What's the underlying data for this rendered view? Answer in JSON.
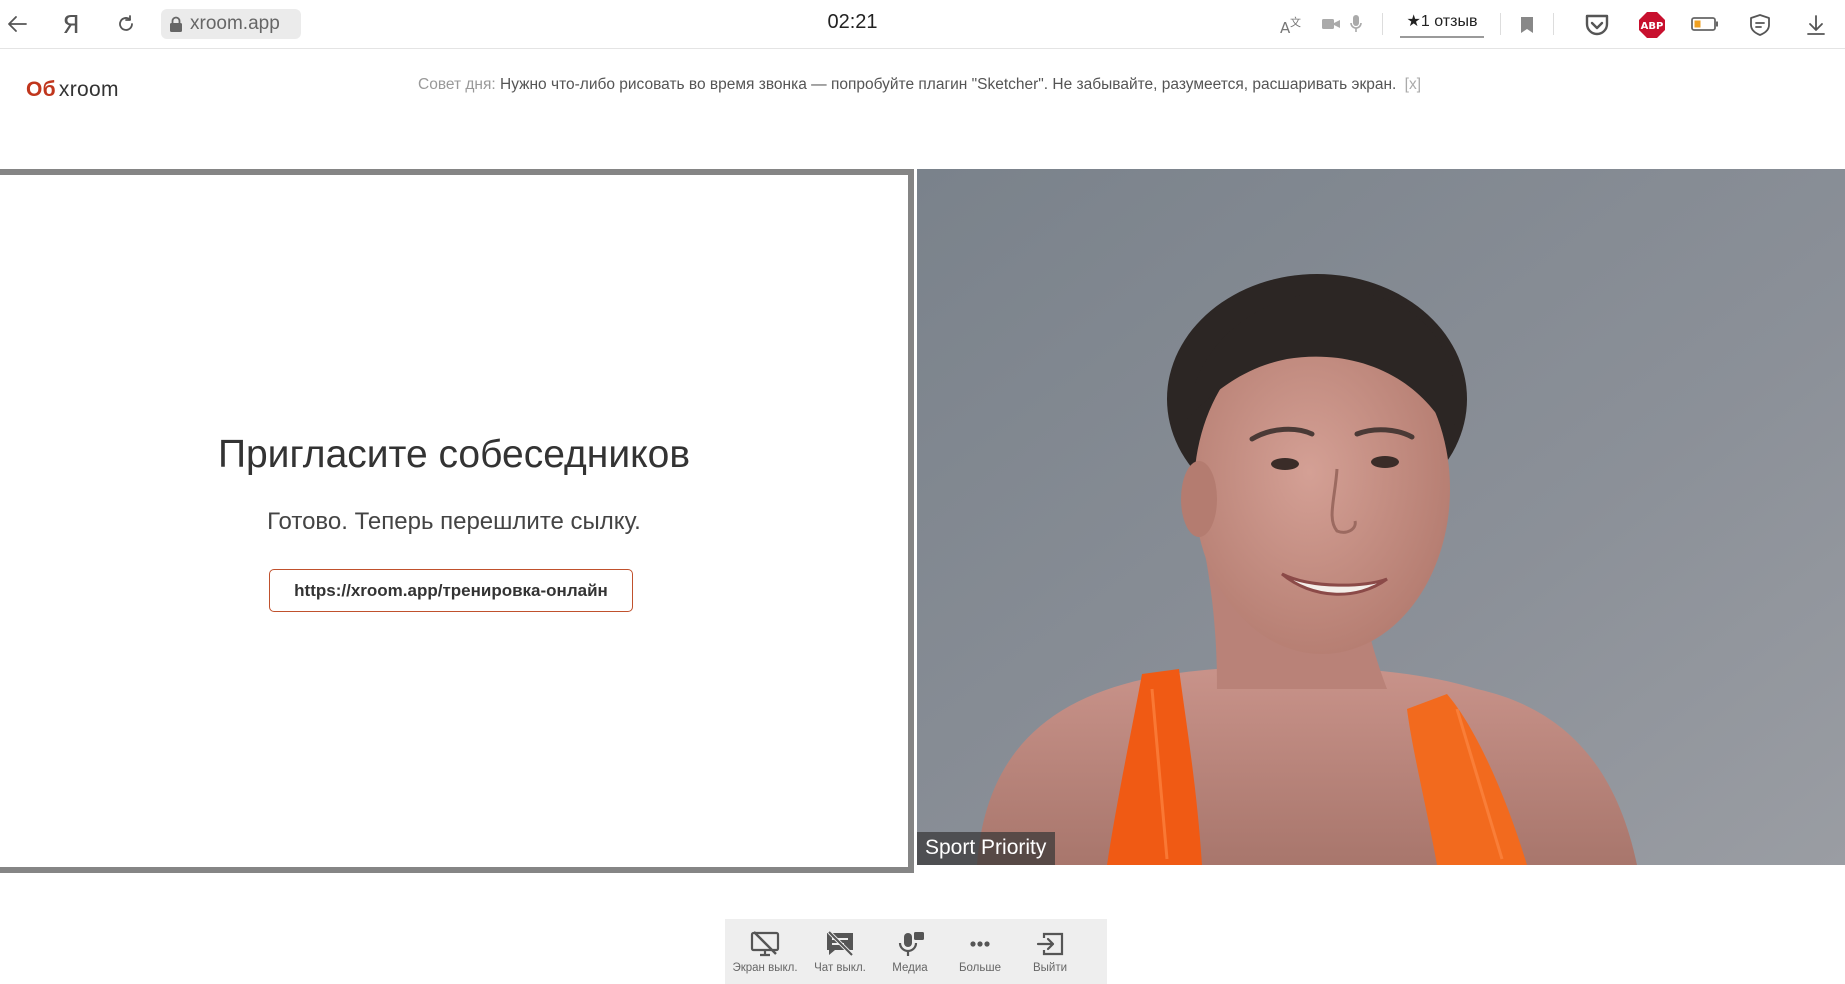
{
  "browser": {
    "url": "xroom.app",
    "time": "02:21",
    "ya_label": "Я",
    "reviews_label": "★1 отзыв",
    "abp_label": "ABP"
  },
  "header": {
    "logo_mark": "Об",
    "logo_name": "xroom",
    "tip_prefix": "Совет дня:",
    "tip_text": "Нужно что-либо рисовать во время звонка — попробуйте плагин \"Sketcher\". Не забывайте, разумеется, расшаривать экран.",
    "tip_close": "[x]"
  },
  "invite": {
    "title": "Пригласите собеседников",
    "subtitle": "Готово. Теперь перешлите сылку.",
    "link": "https://xroom.app/тренировка-онлайн"
  },
  "video": {
    "participant_name": "Sport Priority"
  },
  "toolbar": {
    "items": [
      {
        "label": "Экран выкл.",
        "icon": "screen-off-icon"
      },
      {
        "label": "Чат выкл.",
        "icon": "chat-off-icon"
      },
      {
        "label": "Медиа",
        "icon": "media-icon"
      },
      {
        "label": "Больше",
        "icon": "more-icon"
      },
      {
        "label": "Выйти",
        "icon": "exit-icon"
      }
    ]
  },
  "colors": {
    "accent": "#c0361d",
    "link_border": "#c0512d",
    "panel_border": "#858585",
    "toolbar_bg": "#eeeeee"
  }
}
